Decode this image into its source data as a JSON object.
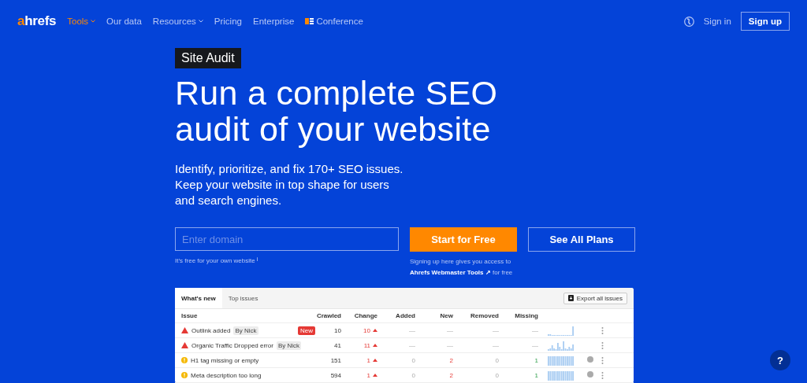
{
  "nav": {
    "logo": {
      "accent": "a",
      "rest": "hrefs"
    },
    "items": [
      {
        "label": "Tools",
        "selected": true,
        "dropdown": true
      },
      {
        "label": "Our data",
        "selected": false,
        "dropdown": false
      },
      {
        "label": "Resources",
        "selected": false,
        "dropdown": true
      },
      {
        "label": "Pricing",
        "selected": false,
        "dropdown": false
      },
      {
        "label": "Enterprise",
        "selected": false,
        "dropdown": false
      },
      {
        "label": "Conference",
        "selected": false,
        "dropdown": false,
        "logo": true
      }
    ],
    "sign_in": "Sign in",
    "sign_up": "Sign up"
  },
  "hero": {
    "badge": "Site Audit",
    "headline": [
      "Run a complete SEO",
      "audit of your website"
    ],
    "description": "Identify, prioritize, and fix 170+ SEO issues. Keep your website in top shape for users and search engines.",
    "domain_placeholder": "Enter domain",
    "primary_button": "Start for Free",
    "secondary_button": "See All Plans",
    "free_note": "It’s free for your own website",
    "free_note_info": "i",
    "signup_note": "Signing up here gives you access to",
    "signup_link": "Ahrefs Webmaster Tools ↗",
    "signup_suffix": "for free"
  },
  "table": {
    "tabs": [
      {
        "label": "What's new",
        "selected": true
      },
      {
        "label": "Top issues",
        "selected": false
      }
    ],
    "export_button": "Export all issues",
    "columns": [
      "Issue",
      "Crawled",
      "Change",
      "Added",
      "New",
      "Removed",
      "Missing"
    ],
    "rows": [
      {
        "kind": "error",
        "issue": "Outlink added",
        "tag": "By Nick",
        "badge": "New",
        "crawled": "10",
        "change": "10",
        "added": "—",
        "new": "—",
        "removed": "—",
        "missing": "—",
        "sparkline": {
          "kind": "spike"
        },
        "help": false
      },
      {
        "kind": "error",
        "issue": "Organic Traffic Dropped error",
        "tag": "By Nick",
        "crawled": "41",
        "change": "11",
        "added": "—",
        "new": "—",
        "removed": "—",
        "missing": "—",
        "sparkline": {
          "kind": "varied"
        },
        "help": false
      },
      {
        "kind": "warning",
        "issue": "H1 tag missing or empty",
        "crawled": "151",
        "change": "1",
        "added": "0",
        "new": "2",
        "removed": "0",
        "missing": "1",
        "sparkline": {
          "kind": "full"
        },
        "help": true
      },
      {
        "kind": "warning",
        "issue": "Meta description too long",
        "crawled": "594",
        "change": "1",
        "added": "0",
        "new": "2",
        "removed": "0",
        "missing": "1",
        "sparkline": {
          "kind": "full"
        },
        "help": true
      }
    ]
  },
  "help_button": "?"
}
